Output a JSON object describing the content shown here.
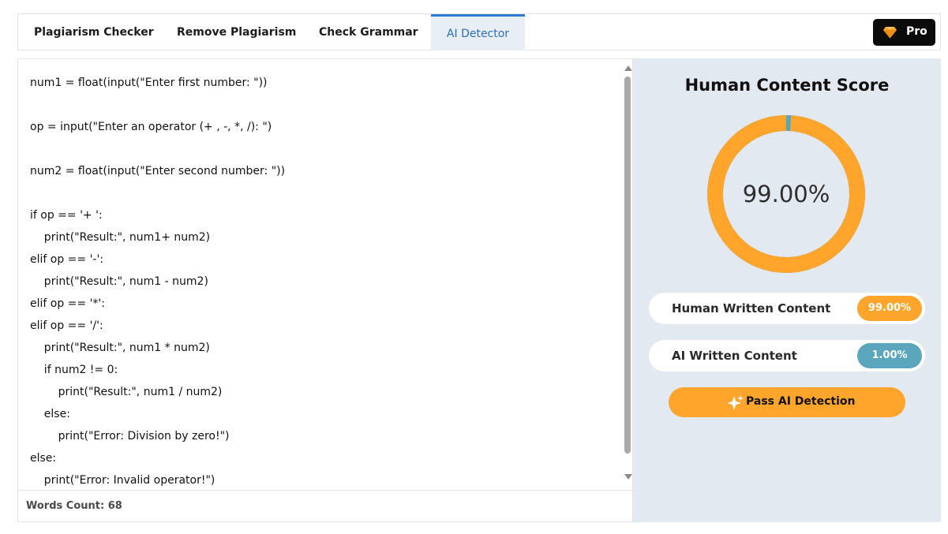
{
  "tabs": [
    {
      "label": "Plagiarism Checker",
      "active": false
    },
    {
      "label": "Remove Plagiarism",
      "active": false
    },
    {
      "label": "Check Grammar",
      "active": false
    },
    {
      "label": "AI Detector",
      "active": true
    }
  ],
  "pro_button": {
    "label": "Pro",
    "icon": "diamond-icon"
  },
  "editor": {
    "lines": [
      "num1 = float(input(\"Enter first number: \"))",
      "",
      "op = input(\"Enter an operator (+ , -, *, /): \")",
      "",
      "num2 = float(input(\"Enter second number: \"))",
      "",
      "if op == '+ ':",
      "    print(\"Result:\", num1+ num2)",
      "elif op == '-':",
      "    print(\"Result:\", num1 - num2)",
      "elif op == '*':",
      "elif op == '/':",
      "    print(\"Result:\", num1 * num2)",
      "    if num2 != 0:",
      "        print(\"Result:\", num1 / num2)",
      "    else:",
      "        print(\"Error: Division by zero!\")",
      "else:",
      "    print(\"Error: Invalid operator!\")"
    ],
    "words_count": "Words Count: 68"
  },
  "result": {
    "title": "Human Content Score",
    "score_label": "99.00%",
    "human_fraction": 0.99,
    "human_label": "Human Written Content",
    "human_value": "99.00%",
    "ai_label": "AI Written Content",
    "ai_value": "1.00%",
    "pass_button": "Pass AI Detection"
  },
  "colors": {
    "accent_orange": "#ffa52c",
    "ai_blue": "#5aa6bd",
    "active_tab_blue": "#2a7ad1",
    "panel_bg": "#e3e9f1"
  }
}
